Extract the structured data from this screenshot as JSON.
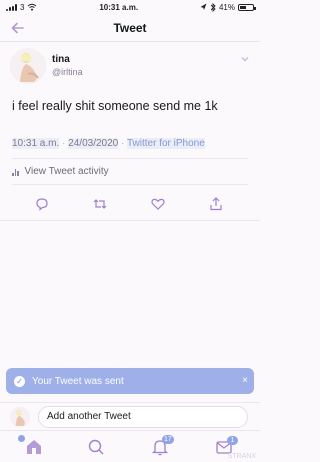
{
  "status_bar": {
    "carrier": "3",
    "time": "10:31 a.m.",
    "battery": "41%",
    "battery_level": 0.41
  },
  "nav": {
    "title": "Tweet",
    "back_icon": "back-arrow-icon"
  },
  "tweet": {
    "name": "tina",
    "handle": "@irltina",
    "text": "i feel really shit someone send me 1k",
    "time": "10:31 a.m.",
    "separator": "·",
    "date": "24/03/2020",
    "source": "Twitter for iPhone",
    "activity_label": "View Tweet activity"
  },
  "actions": [
    "reply-icon",
    "retweet-icon",
    "like-icon",
    "share-icon"
  ],
  "toast": {
    "text": "Your Tweet was sent",
    "close": "×"
  },
  "reply": {
    "placeholder": "Add another Tweet"
  },
  "tabs": {
    "items": [
      "home-icon",
      "search-icon",
      "notifications-icon",
      "messages-icon"
    ],
    "notifications_badge": "17",
    "messages_badge": "1"
  },
  "watermark": "STRANX",
  "colors": {
    "accent": "#8fa4e6",
    "lilac": "#b49ad6",
    "background": "#fbf9fb"
  }
}
